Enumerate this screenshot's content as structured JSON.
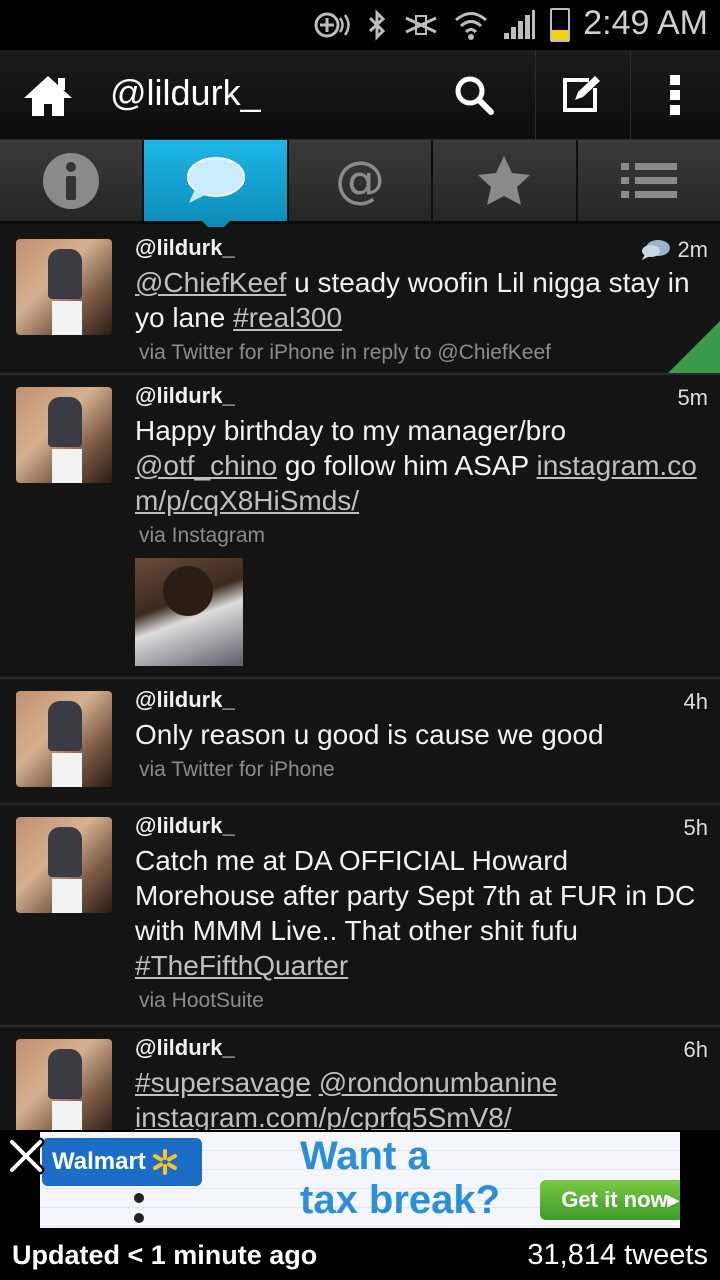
{
  "status_bar": {
    "time": "2:49 AM",
    "icons": [
      "nfc-icon",
      "bluetooth-icon",
      "mute-icon",
      "wifi-icon",
      "signal-icon",
      "battery-icon"
    ]
  },
  "action_bar": {
    "title": "@lildurk_",
    "buttons": [
      "home-icon",
      "search-icon",
      "compose-icon",
      "overflow-menu-icon"
    ]
  },
  "tabs": [
    {
      "icon": "info-icon",
      "active": false
    },
    {
      "icon": "speech-bubble-icon",
      "active": true
    },
    {
      "icon": "at-mention-icon",
      "active": false
    },
    {
      "icon": "star-icon",
      "active": false
    },
    {
      "icon": "list-icon",
      "active": false
    }
  ],
  "tweets": [
    {
      "handle": "@lildurk_",
      "time": "2m",
      "text_parts": [
        "@ChiefKeef",
        " u steady woofin Lil nigga stay in yo lane ",
        "#real300"
      ],
      "via": "via Twitter for iPhone in reply to @ChiefKeef"
    },
    {
      "handle": "@lildurk_",
      "time": "5m",
      "text_parts": [
        "Happy birthday to my manager/bro ",
        "@otf_chino",
        " go follow him ASAP ",
        "instagram.com/p/cqX8HiSmds/"
      ],
      "via": "via Instagram"
    },
    {
      "handle": "@lildurk_",
      "time": "4h",
      "text": "Only reason u good is cause we good",
      "via": "via Twitter for iPhone"
    },
    {
      "handle": "@lildurk_",
      "time": "5h",
      "text_parts": [
        "Catch me at DA OFFICIAL Howard Morehouse after party Sept 7th at FUR in DC with MMM Live.. That other shit fufu ",
        "#TheFifthQuarter"
      ],
      "via": "via HootSuite"
    },
    {
      "handle": "@lildurk_",
      "time": "6h",
      "text_parts": [
        "#supersavage",
        " ",
        "@rondonumbanine",
        " ",
        "instagram.com/p/cprfq5SmV8/"
      ]
    }
  ],
  "ad": {
    "brand": "Walmart",
    "headline_line1": "Want a",
    "headline_line2": "tax break?",
    "cta": "Get it now"
  },
  "footer": {
    "updated": "Updated < 1 minute ago",
    "count": "31,814 tweets"
  }
}
